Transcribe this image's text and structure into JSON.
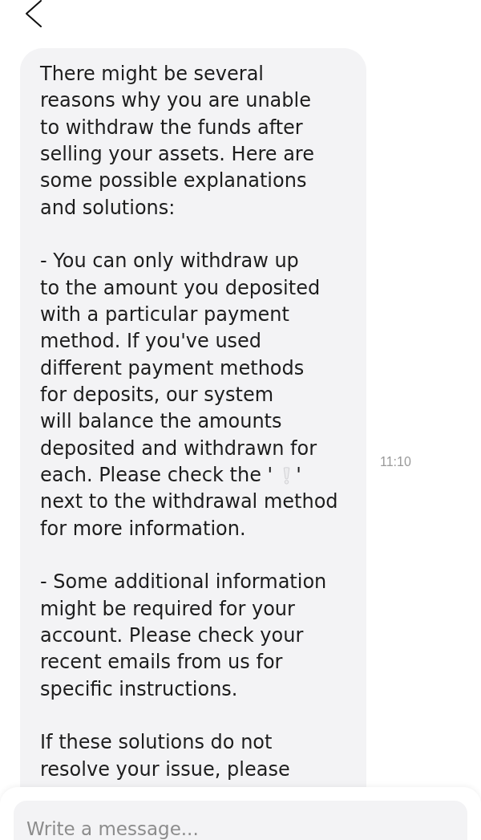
{
  "message": {
    "paragraphs": [
      {
        "segments": [
          {
            "kind": "text",
            "lines": [
              "There might be several",
              "reasons why you are unable",
              "to withdraw the funds after",
              "selling your assets. Here are",
              "some possible explanations",
              "and solutions:"
            ]
          }
        ]
      },
      {
        "segments": [
          {
            "kind": "text",
            "lines": [
              "- You can only withdraw up",
              "to the amount you deposited",
              "with a particular payment",
              "method. If you've used",
              "different payment methods",
              "for deposits, our system",
              "will balance the amounts",
              "deposited and withdrawn for"
            ]
          },
          {
            "kind": "emoji",
            "before": "each. Please check the '",
            "after": "'"
          },
          {
            "kind": "text",
            "lines": [
              "next to the withdrawal method",
              "for more information."
            ]
          }
        ]
      },
      {
        "segments": [
          {
            "kind": "text",
            "lines": [
              "- Some additional information",
              "might be required for your",
              "account. Please check your",
              "recent emails from us for",
              "specific instructions."
            ]
          }
        ]
      },
      {
        "segments": [
          {
            "kind": "text",
            "lines": [
              "If these solutions do not",
              "resolve your issue, please"
            ]
          }
        ]
      }
    ],
    "time": "11:10"
  },
  "composer": {
    "placeholder": "Write a message..."
  }
}
